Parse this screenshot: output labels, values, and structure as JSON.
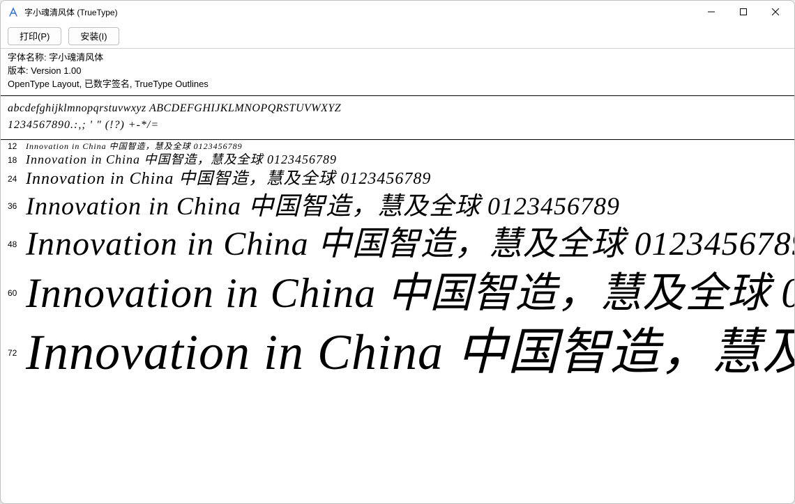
{
  "window": {
    "title": "字小魂清风体 (TrueType)"
  },
  "toolbar": {
    "print_label": "打印(P)",
    "install_label": "安装(I)"
  },
  "meta": {
    "name_label": "字体名称: ",
    "name_value": "字小魂清风体",
    "version_label": "版本: ",
    "version_value": "Version 1.00",
    "features": "OpenType Layout, 已数字签名, TrueType Outlines"
  },
  "charset": {
    "alpha": "abcdefghijklmnopqrstuvwxyz ABCDEFGHIJKLMNOPQRSTUVWXYZ",
    "digits": "1234567890.:,; ' \" (!?) +-*/="
  },
  "sample_text": "Innovation in China 中国智造，慧及全球 0123456789",
  "samples": [
    {
      "size": 12
    },
    {
      "size": 18
    },
    {
      "size": 24
    },
    {
      "size": 36
    },
    {
      "size": 48
    },
    {
      "size": 60
    },
    {
      "size": 72
    }
  ]
}
